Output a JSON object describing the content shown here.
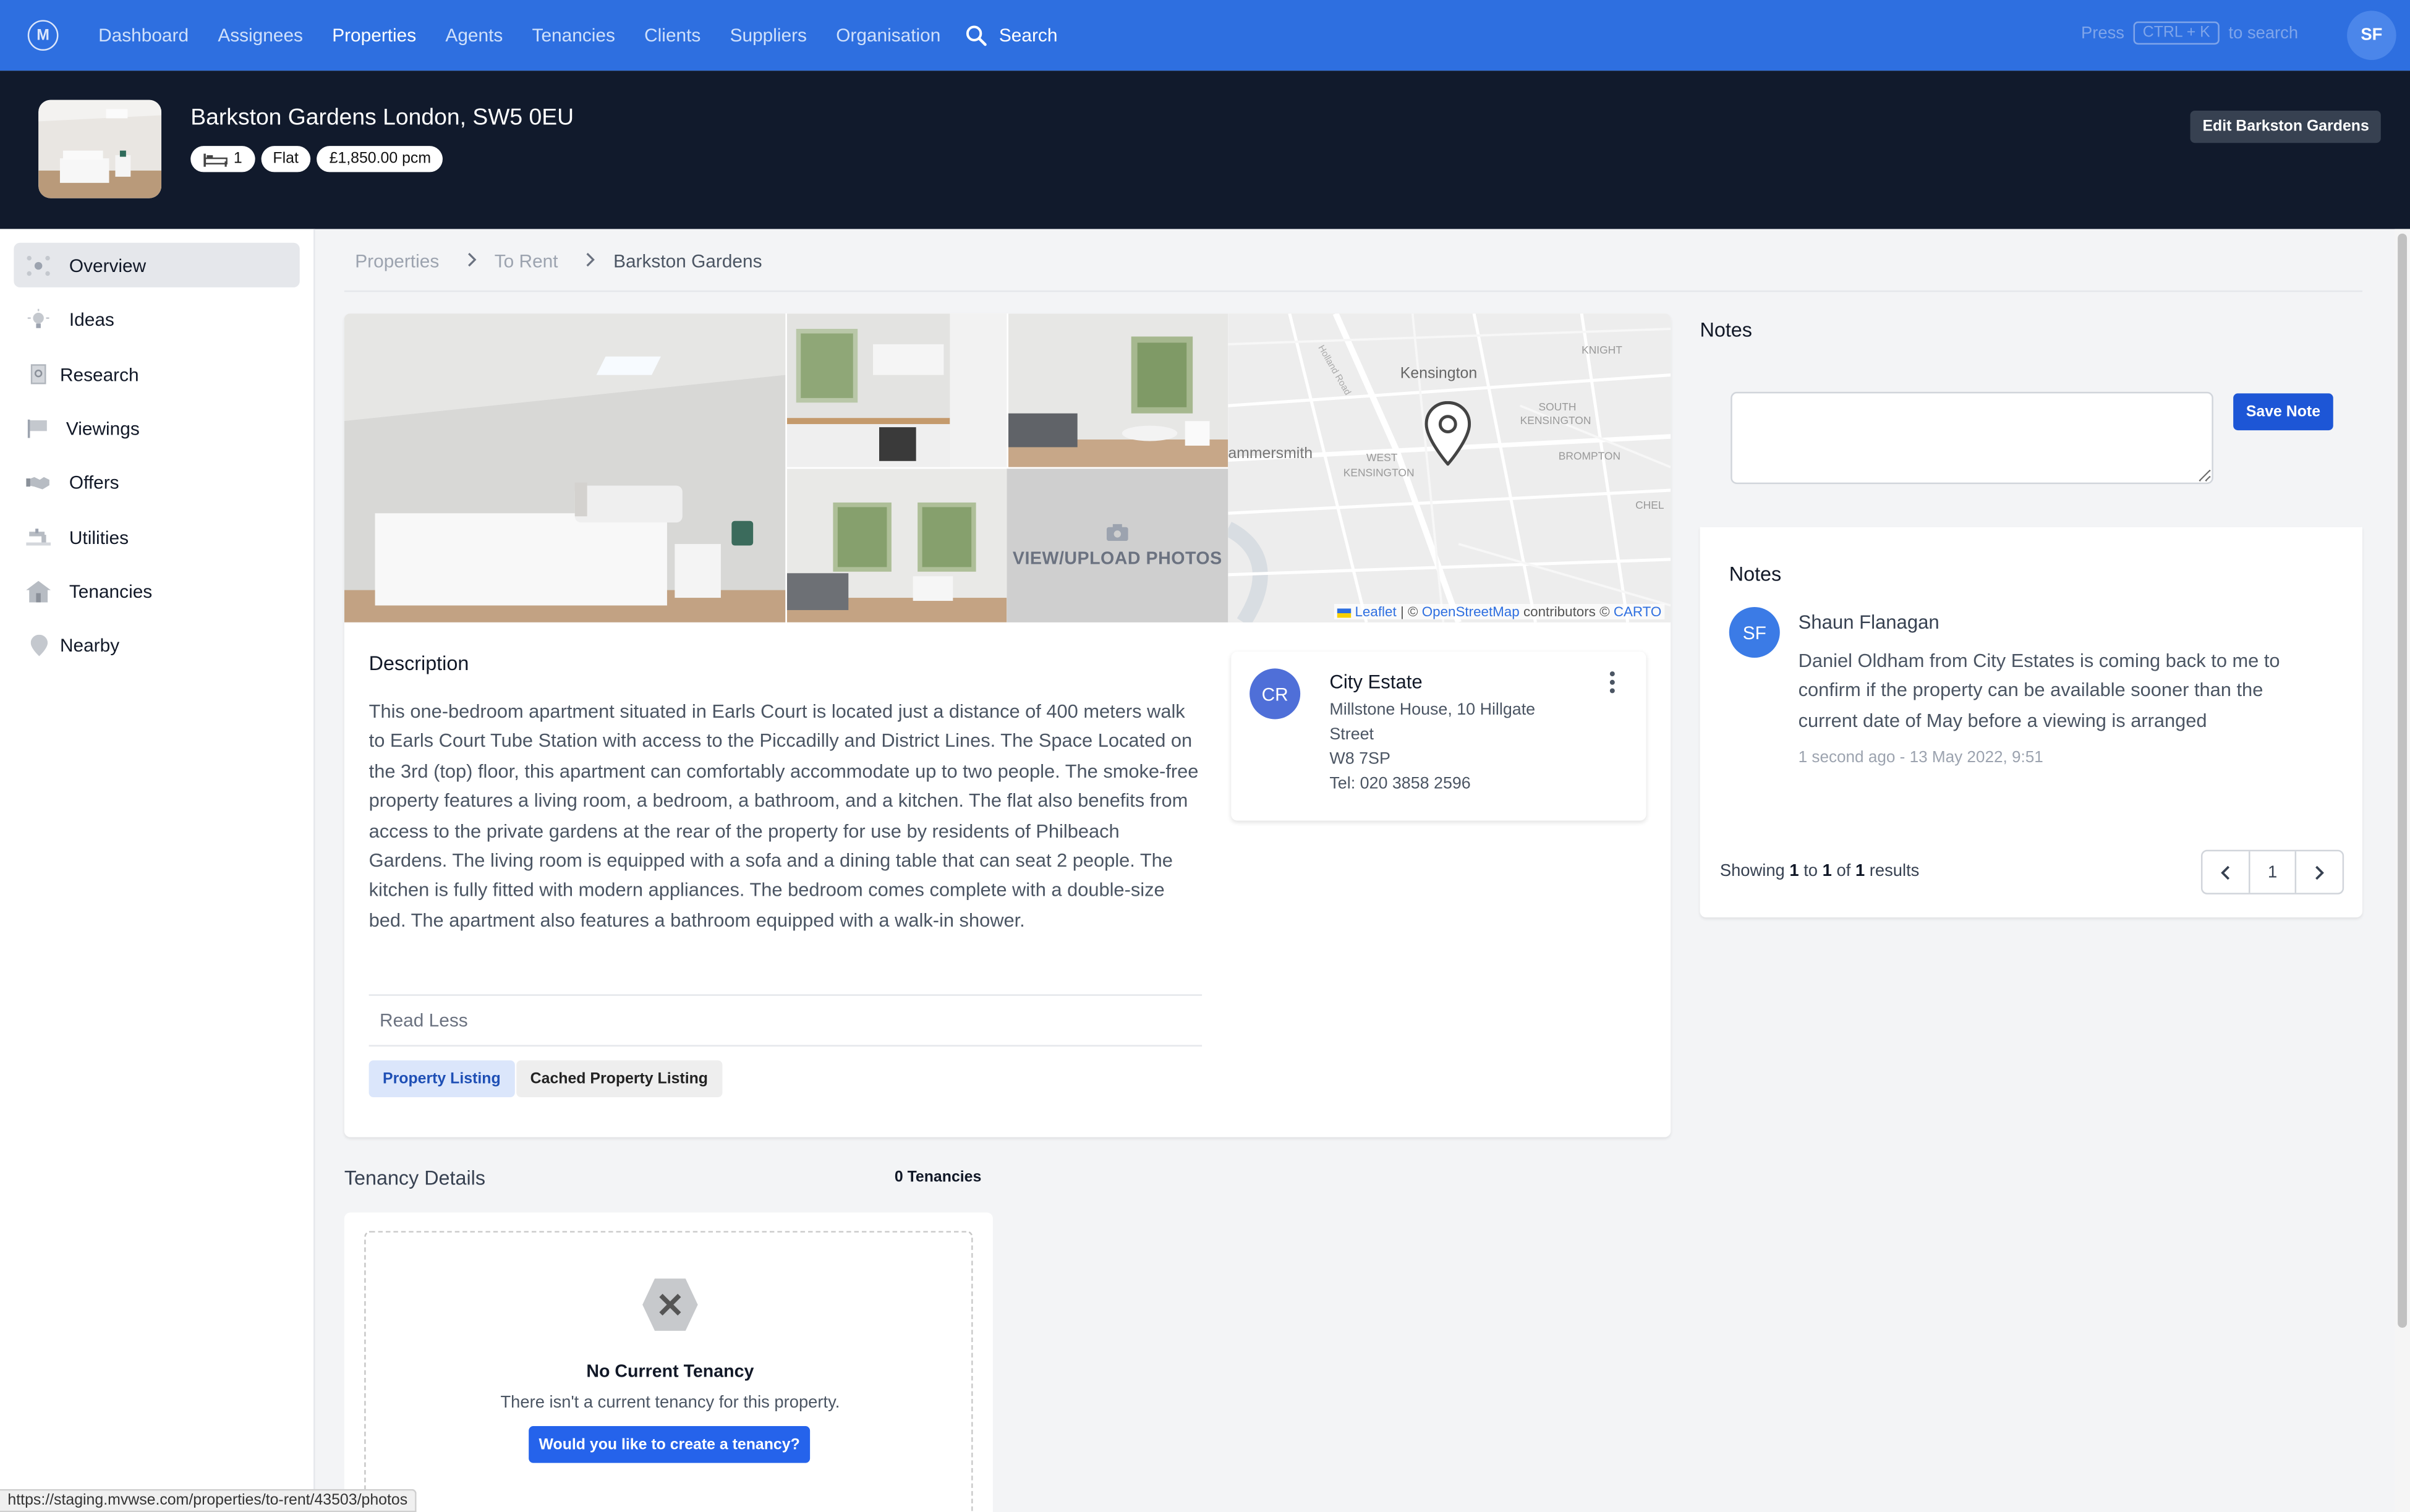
{
  "topnav": {
    "items": [
      {
        "label": "Dashboard",
        "active": false
      },
      {
        "label": "Assignees",
        "active": false
      },
      {
        "label": "Properties",
        "active": true
      },
      {
        "label": "Agents",
        "active": false
      },
      {
        "label": "Tenancies",
        "active": false
      },
      {
        "label": "Clients",
        "active": false
      },
      {
        "label": "Suppliers",
        "active": false
      },
      {
        "label": "Organisation",
        "active": false
      }
    ],
    "search_label": "Search",
    "hint_press": "Press",
    "hint_keys": "CTRL + K",
    "hint_suffix": "to search",
    "user_initials": "SF"
  },
  "property": {
    "title": "Barkston Gardens London, SW5 0EU",
    "bedrooms": "1",
    "type": "Flat",
    "price": "£1,850.00 pcm",
    "edit_label": "Edit Barkston Gardens"
  },
  "sidebar": {
    "items": [
      {
        "label": "Overview",
        "icon": "overview-icon"
      },
      {
        "label": "Ideas",
        "icon": "lightbulb-icon"
      },
      {
        "label": "Research",
        "icon": "research-icon"
      },
      {
        "label": "Viewings",
        "icon": "flag-icon"
      },
      {
        "label": "Offers",
        "icon": "handshake-icon"
      },
      {
        "label": "Utilities",
        "icon": "tap-icon"
      },
      {
        "label": "Tenancies",
        "icon": "house-icon"
      },
      {
        "label": "Nearby",
        "icon": "location-pin-icon"
      }
    ]
  },
  "breadcrumb": [
    "Properties",
    "To Rent",
    "Barkston Gardens"
  ],
  "gallery": {
    "upload_label": "VIEW/UPLOAD PHOTOS",
    "map_labels": {
      "kensington": "Kensington",
      "south_kensington_1": "SOUTH",
      "south_kensington_2": "KENSINGTON",
      "brompton": "BROMPTON",
      "west_kensington_1": "WEST",
      "west_kensington_2": "KENSINGTON",
      "hammersmith": "ammersmith",
      "knightsbridge": "KNIGHT",
      "chelsea": "CHEL",
      "holland_road": "Holland Road"
    },
    "map_attribution": {
      "leaflet": "Leaflet",
      "sep": "| ©",
      "osm": "OpenStreetMap",
      "contrib": "contributors ©",
      "carto": "CARTO"
    }
  },
  "description": {
    "heading": "Description",
    "text": "This one-bedroom apartment situated in Earls Court is located just a distance of 400 meters walk to Earls Court Tube Station with access to the Piccadilly and District Lines. The Space Located on the 3rd (top) floor, this apartment can comfortably accommodate up to two people. The smoke-free property features a living room, a bedroom, a bathroom, and a kitchen. The flat also benefits from access to the private gardens at the rear of the property for use by residents of Philbeach Gardens. The living room is equipped with a sofa and a dining table that can seat 2 people. The kitchen is fully fitted with modern appliances. The bedroom comes complete with a double-size bed. The apartment also features a bathroom equipped with a walk-in shower.",
    "read_less": "Read Less",
    "tabs": [
      "Property Listing",
      "Cached Property Listing"
    ]
  },
  "agent": {
    "initials": "CR",
    "name": "City Estate",
    "address_1": "Millstone House, 10 Hillgate",
    "address_2": "Street",
    "postcode": "W8 7SP",
    "tel": "Tel: 020 3858 2596"
  },
  "tenancy": {
    "heading": "Tenancy Details",
    "count": "0 Tenancies",
    "empty_title": "No Current Tenancy",
    "empty_sub": "There isn't a current tenancy for this property.",
    "create_label": "Would you like to create a tenancy?"
  },
  "notes": {
    "heading": "Notes",
    "input_placeholder": "",
    "save_label": "Save Note",
    "list_title": "Notes",
    "entry": {
      "initials": "SF",
      "author": "Shaun Flanagan",
      "body": "Daniel Oldham from City Estates is coming back to me to confirm if the property can be available sooner than the current date of May before a viewing is arranged",
      "time": "1 second ago -  13 May 2022, 9:51"
    },
    "showing": {
      "prefix": "Showing",
      "from": "1",
      "to_word": "to",
      "to": "1",
      "of_word": "of",
      "total": "1",
      "suffix": "results"
    },
    "page": "1"
  },
  "status_url": "https://staging.mvwse.com/properties/to-rent/43503/photos",
  "colors": {
    "nav_blue": "#2e6fe0",
    "header_dark": "#111a2c",
    "primary_button": "#2563eb"
  }
}
